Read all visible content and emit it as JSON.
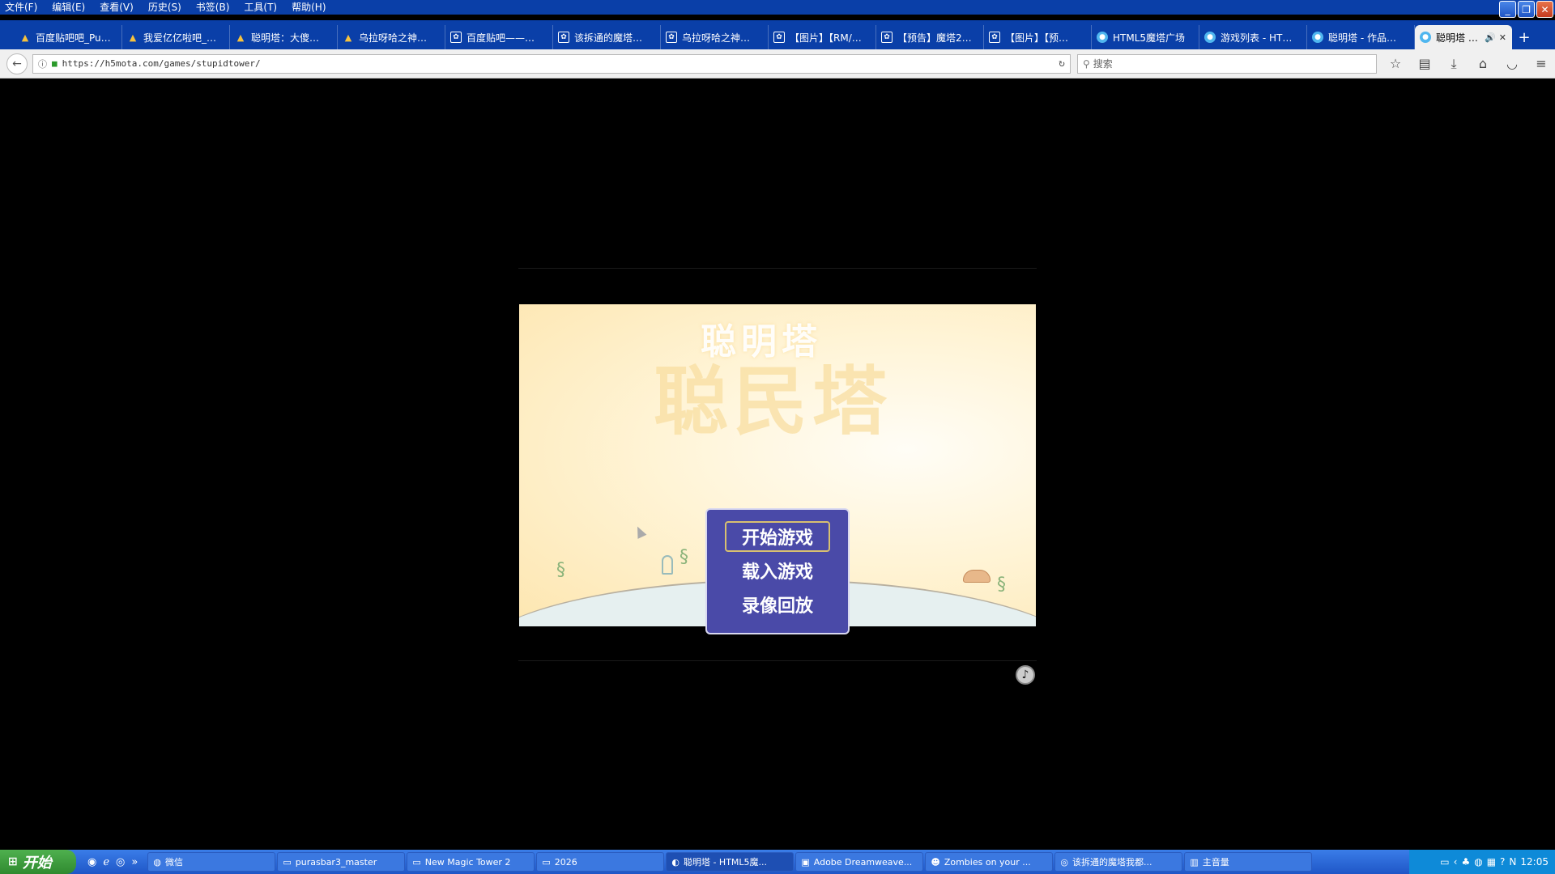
{
  "menubar": [
    "文件(F)",
    "编辑(E)",
    "查看(V)",
    "历史(S)",
    "书签(B)",
    "工具(T)",
    "帮助(H)"
  ],
  "window_controls": {
    "minimize": "_",
    "restore": "❐",
    "close": "✕"
  },
  "tabs": [
    {
      "label": "百度贴吧吧_Pu…",
      "icon": "baidu-tieba-icon"
    },
    {
      "label": "我爱亿亿啦吧_…",
      "icon": "baidu-tieba-icon"
    },
    {
      "label": "聪明塔：大傻…",
      "icon": "baidu-tieba-icon"
    },
    {
      "label": "乌拉呀哈之神…",
      "icon": "baidu-tieba-icon"
    },
    {
      "label": "百度贴吧——…",
      "icon": "paw-icon"
    },
    {
      "label": "该拆通的魔塔…",
      "icon": "paw-icon"
    },
    {
      "label": "乌拉呀哈之神…",
      "icon": "paw-icon"
    },
    {
      "label": "【图片】【RM/…",
      "icon": "paw-icon"
    },
    {
      "label": "【预告】魔塔2…",
      "icon": "paw-icon"
    },
    {
      "label": "【图片】【预…",
      "icon": "paw-icon"
    },
    {
      "label": "HTML5魔塔广场",
      "icon": "h5mota-icon"
    },
    {
      "label": "游戏列表 - HT…",
      "icon": "h5mota-icon"
    },
    {
      "label": "聪明塔 - 作品…",
      "icon": "h5mota-icon"
    }
  ],
  "active_tab": {
    "label": "聪明塔 …",
    "icon": "h5mota-icon"
  },
  "newtab": "+",
  "urlbar": {
    "url": "https://h5mota.com/games/stupidtower/"
  },
  "searchbar": {
    "placeholder": "搜索"
  },
  "game": {
    "title_small": "聪明塔",
    "title_big": "聪民塔",
    "menu": [
      "开始游戏",
      "载入游戏",
      "录像回放"
    ],
    "selected_index": 0,
    "music_icon": "♪"
  },
  "taskbar": {
    "start_label": "开始",
    "tasks": [
      {
        "label": "微信",
        "icon": "wechat-icon"
      },
      {
        "label": "purasbar3_master",
        "icon": "folder-icon"
      },
      {
        "label": "New Magic Tower 2",
        "icon": "folder-icon"
      },
      {
        "label": "2026",
        "icon": "folder-icon"
      },
      {
        "label": "聪明塔 - HTML5魔...",
        "icon": "firefox-icon"
      },
      {
        "label": "Adobe Dreamweave...",
        "icon": "dreamweaver-icon"
      },
      {
        "label": "Zombies on your ...",
        "icon": "zombie-icon"
      },
      {
        "label": "该拆通的魔塔我都...",
        "icon": "chrome-icon"
      },
      {
        "label": "主音量",
        "icon": "volume-icon"
      }
    ],
    "clock": "12:05"
  }
}
